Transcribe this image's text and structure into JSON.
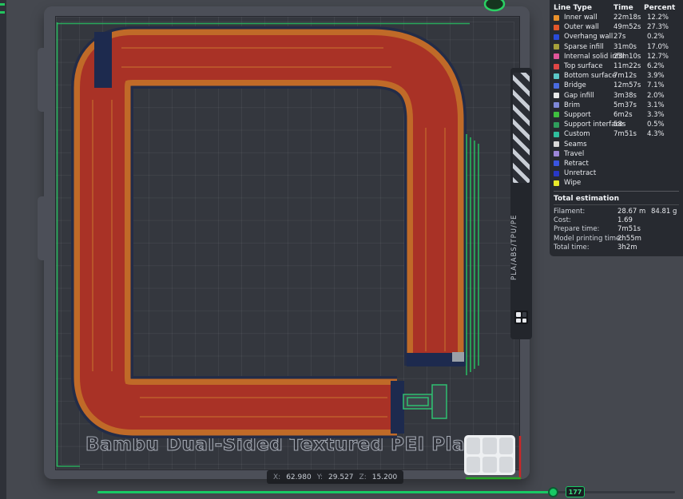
{
  "plate": {
    "label": "Bambu Dual-Sided Textured PEI Plate",
    "side_label": "PLA/ABS/TPU/PE"
  },
  "legend": {
    "headers": {
      "type": "Line Type",
      "time": "Time",
      "percent": "Percent"
    },
    "rows": [
      {
        "label": "Inner wall",
        "color": "#E8912C",
        "time": "22m18s",
        "percent": "12.2%"
      },
      {
        "label": "Outer wall",
        "color": "#E2572B",
        "time": "49m52s",
        "percent": "27.3%"
      },
      {
        "label": "Overhang wall",
        "color": "#2A4BD8",
        "time": "27s",
        "percent": "0.2%"
      },
      {
        "label": "Sparse infill",
        "color": "#A6A03A",
        "time": "31m0s",
        "percent": "17.0%"
      },
      {
        "label": "Internal solid infill",
        "color": "#E0559A",
        "time": "23m10s",
        "percent": "12.7%"
      },
      {
        "label": "Top surface",
        "color": "#E04646",
        "time": "11m22s",
        "percent": "6.2%"
      },
      {
        "label": "Bottom surface",
        "color": "#5AC8C8",
        "time": "7m12s",
        "percent": "3.9%"
      },
      {
        "label": "Bridge",
        "color": "#4A6BE0",
        "time": "12m57s",
        "percent": "7.1%"
      },
      {
        "label": "Gap infill",
        "color": "#E8E8E8",
        "time": "3m38s",
        "percent": "2.0%"
      },
      {
        "label": "Brim",
        "color": "#7E88D8",
        "time": "5m37s",
        "percent": "3.1%"
      },
      {
        "label": "Support",
        "color": "#3FBF3F",
        "time": "6m2s",
        "percent": "3.3%"
      },
      {
        "label": "Support interface",
        "color": "#2F9E5C",
        "time": "58s",
        "percent": "0.5%"
      },
      {
        "label": "Custom",
        "color": "#2FBF9E",
        "time": "7m51s",
        "percent": "4.3%"
      },
      {
        "label": "Seams",
        "color": "#D8D8D8",
        "time": "",
        "percent": ""
      },
      {
        "label": "Travel",
        "color": "#9C86D8",
        "time": "",
        "percent": ""
      },
      {
        "label": "Retract",
        "color": "#3A55E0",
        "time": "",
        "percent": ""
      },
      {
        "label": "Unretract",
        "color": "#2838C8",
        "time": "",
        "percent": ""
      },
      {
        "label": "Wipe",
        "color": "#E8E82A",
        "time": "",
        "percent": ""
      }
    ],
    "total": {
      "title": "Total estimation",
      "rows": [
        {
          "label": "Filament:",
          "value": "28.67 m",
          "value2": "84.81 g"
        },
        {
          "label": "Cost:",
          "value": "1.69",
          "value2": ""
        },
        {
          "label": "Prepare time:",
          "value": "7m51s",
          "value2": ""
        },
        {
          "label": "Model printing time:",
          "value": "2h55m",
          "value2": ""
        },
        {
          "label": "Total time:",
          "value": "3h2m",
          "value2": ""
        }
      ]
    }
  },
  "statusbar": {
    "x_label": "X:",
    "x_value": "62.980",
    "y_label": "Y:",
    "y_value": "29.527",
    "z_label": "Z:",
    "z_value": "15.200"
  },
  "slider": {
    "value": "177",
    "accent_color": "#17C964"
  }
}
